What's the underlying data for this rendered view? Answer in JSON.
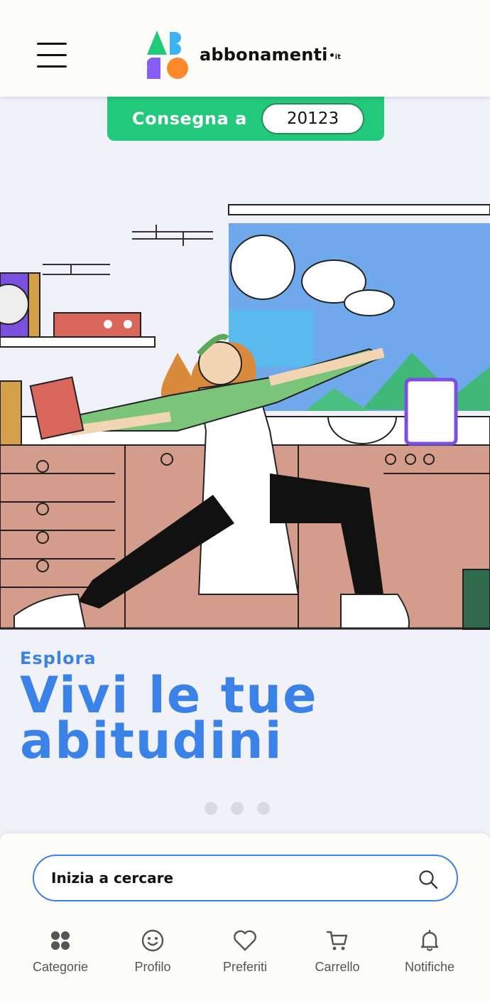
{
  "header": {
    "logo_text": "abbonamenti",
    "logo_suffix": "it",
    "menu_icon": "hamburger-icon"
  },
  "delivery": {
    "label": "Consegna a",
    "zip": "20123"
  },
  "hero": {
    "eyebrow": "Esplora",
    "title": "Vivi le tue abitudini",
    "slides_total": 3
  },
  "search": {
    "placeholder": "Inizia a cercare",
    "icon": "search-icon"
  },
  "nav": {
    "items": [
      {
        "label": "Categorie",
        "icon": "grid-icon"
      },
      {
        "label": "Profilo",
        "icon": "smiley-icon"
      },
      {
        "label": "Preferiti",
        "icon": "heart-icon"
      },
      {
        "label": "Carrello",
        "icon": "cart-icon"
      },
      {
        "label": "Notifiche",
        "icon": "bell-icon"
      }
    ]
  },
  "colors": {
    "accent": "#3b82e8",
    "delivery_green": "#22c97a",
    "background": "#f1f1fa"
  }
}
